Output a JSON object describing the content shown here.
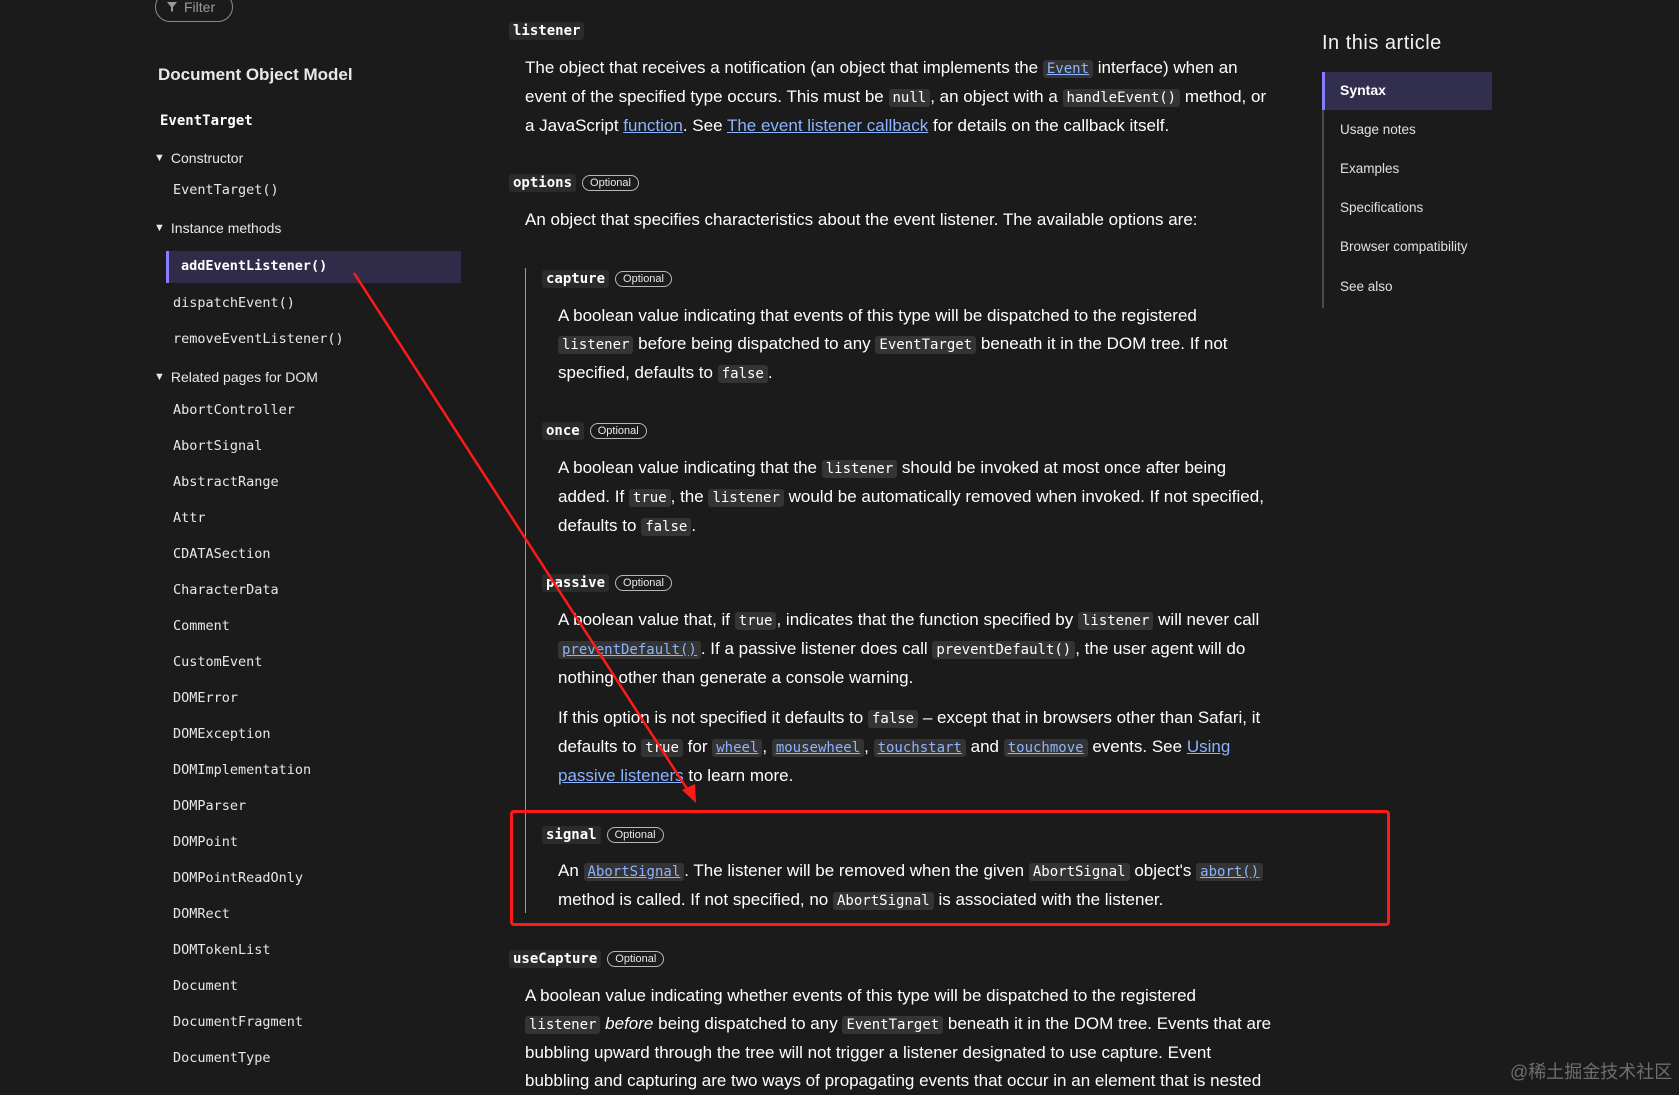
{
  "sidebar": {
    "filter_label": "Filter",
    "heading": "Document Object Model",
    "interface": "EventTarget",
    "groups": [
      {
        "label": "Constructor",
        "items": [
          "EventTarget()"
        ]
      },
      {
        "label": "Instance methods",
        "items": [
          "addEventListener()",
          "dispatchEvent()",
          "removeEventListener()"
        ]
      },
      {
        "label": "Related pages for DOM",
        "items": [
          "AbortController",
          "AbortSignal",
          "AbstractRange",
          "Attr",
          "CDATASection",
          "CharacterData",
          "Comment",
          "CustomEvent",
          "DOMError",
          "DOMException",
          "DOMImplementation",
          "DOMParser",
          "DOMPoint",
          "DOMPointReadOnly",
          "DOMRect",
          "DOMTokenList",
          "Document",
          "DocumentFragment",
          "DocumentType"
        ]
      }
    ],
    "active_item": "addEventListener()"
  },
  "content": {
    "optional_badge": "Optional",
    "listener": {
      "term": "listener",
      "l1a": "The object that receives a notification (an object that implements the",
      "l1_link": "Event",
      "l1b": "interface) when an",
      "l2a": "event of the specified type occurs. This must be",
      "l2_code1": "null",
      "l2b": ", an object with a",
      "l2_code2": "handleEvent()",
      "l2c": "method, or",
      "l3a": "a JavaScript",
      "l3_link1": "function",
      "l3b": ". See",
      "l3_link2": "The event listener callback",
      "l3c": "for details on the callback itself."
    },
    "options": {
      "term": "options",
      "desc": "An object that specifies characteristics about the event listener. The available options are:"
    },
    "capture": {
      "term": "capture",
      "l1": "A boolean value indicating that events of this type will be dispatched to the registered",
      "l2_code1": "listener",
      "l2a": "before being dispatched to any",
      "l2_code2": "EventTarget",
      "l2b": "beneath it in the DOM tree. If not",
      "l3a": "specified, defaults to",
      "l3_code": "false",
      "l3b": "."
    },
    "once": {
      "term": "once",
      "l1a": "A boolean value indicating that the",
      "l1_code": "listener",
      "l1b": "should be invoked at most once after being",
      "l2a": "added. If",
      "l2_code1": "true",
      "l2b": ", the",
      "l2_code2": "listener",
      "l2c": "would be automatically removed when invoked. If not specified,",
      "l3a": "defaults to",
      "l3_code": "false",
      "l3b": "."
    },
    "passive": {
      "term": "passive",
      "l1a": "A boolean value that, if",
      "l1_code1": "true",
      "l1b": ", indicates that the function specified by",
      "l1_code2": "listener",
      "l1c": "will never call",
      "l2_link": "preventDefault()",
      "l2a": ". If a passive listener does call",
      "l2_code": "preventDefault()",
      "l2b": ", the user agent will do",
      "l3": "nothing other than generate a console warning.",
      "l4a": "If this option is not specified it defaults to",
      "l4_code": "false",
      "l4b": "– except that in browsers other than Safari, it",
      "l5a": "defaults to",
      "l5_code": "true",
      "l5b": "for",
      "l5_link1": "wheel",
      "l5_link2": "mousewheel",
      "l5_link3": "touchstart",
      "l5c": "and",
      "l5_link4": "touchmove",
      "l5d": "events. See",
      "l5_link5": "Using",
      "l6_link": "passive listeners",
      "l6a": "to learn more."
    },
    "signal": {
      "term": "signal",
      "l1a": "An",
      "l1_link1": "AbortSignal",
      "l1b": ". The listener will be removed when the given",
      "l1_code": "AbortSignal",
      "l1c": "object's",
      "l1_link2": "abort()",
      "l2a": "method is called. If not specified, no",
      "l2_code": "AbortSignal",
      "l2b": "is associated with the listener."
    },
    "useCapture": {
      "term": "useCapture",
      "l1": "A boolean value indicating whether events of this type will be dispatched to the registered",
      "l2_code1": "listener",
      "l2_em": "before",
      "l2a": "being dispatched to any",
      "l2_code2": "EventTarget",
      "l2b": "beneath it in the DOM tree. Events that are",
      "l3": "bubbling upward through the tree will not trigger a listener designated to use capture. Event",
      "l4": "bubbling and capturing are two ways of propagating events that occur in an element that is nested"
    }
  },
  "toc": {
    "title": "In this article",
    "items": [
      "Syntax",
      "Usage notes",
      "Examples",
      "Specifications",
      "Browser compatibility",
      "See also"
    ],
    "active": "Syntax"
  },
  "annotation": {
    "color": "#ff1a1a"
  },
  "watermark": "@稀土掘金技术社区"
}
